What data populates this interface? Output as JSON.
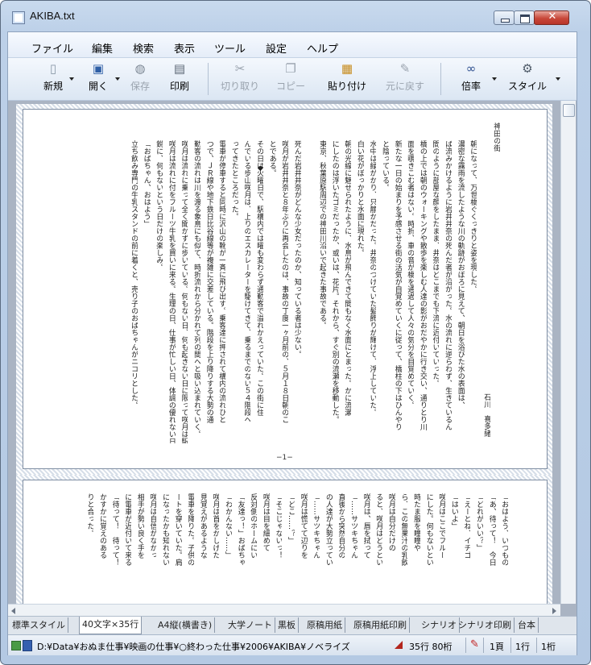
{
  "window": {
    "title": "AKIBA.txt",
    "close_glyph": "✕"
  },
  "menu": [
    "ファイル",
    "編集",
    "検索",
    "表示",
    "ツール",
    "設定",
    "ヘルプ"
  ],
  "toolbar": [
    {
      "label": "新規",
      "icon": "new-file-icon",
      "glyph": "▯"
    },
    {
      "label": "開く",
      "icon": "open-icon",
      "glyph": "▣"
    },
    {
      "label": "保存",
      "icon": "save-icon",
      "glyph": "◍"
    },
    {
      "label": "印刷",
      "icon": "print-icon",
      "glyph": "▤"
    },
    {
      "label": "切り取り",
      "icon": "cut-icon",
      "glyph": "✂"
    },
    {
      "label": "コピー",
      "icon": "copy-icon",
      "glyph": "❐"
    },
    {
      "label": "貼り付け",
      "icon": "paste-icon",
      "glyph": "▦"
    },
    {
      "label": "元に戻す",
      "icon": "undo-icon",
      "glyph": "✎"
    },
    {
      "label": "倍率",
      "icon": "zoom-icon",
      "glyph": "∞"
    },
    {
      "label": "スタイル",
      "icon": "style-icon",
      "glyph": "⚙"
    }
  ],
  "page1": {
    "title": "神田の街",
    "author": "石川　喜多緒",
    "page_number": "−1−",
    "separator": "◆",
    "columns": [
      "朝になって、万世橋ぐくっきりと姿を現した。",
      "濃密な霧雨を流したような川の軌跡がおぼろに見えて、朝日を浴びた水の表面は、",
      "ば流みかけるように岩井井奈の死んだ者が沿がった。水の流れに逆らわず、生きているん",
      "間のように部屋な顔をしたまま、井奈はどこまでも下流に近付いていった。",
      "橋の上では朝のウォーキングや散歩を楽しむ人達の影がおだやかに行き交い、通りとり川",
      "面を覗きこむ者はない。時折、車の音が橋を通過して人々の気分を目覚めていく。",
      "新たな一日の始まりを予感させる街の活気が自覚めていくに従って、橋柱の下はひんやり",
      "と陰っている。",
      "水中は緑がかり、只静かだった。井奈のつけていた髪飾りが輝けて、浮上していた。",
      "白い花がぽっかりと水面に現れた。",
      "朝の光線に魅せられたように、水鳥が飛んできて間もなく水面にとまった。かに流瀬",
      "にしたのは浮いたゴミだったか、或いは、花片。それから、すぐ別の流瀬を移動した。",
      "東京、秋葉原駅周辺での神田川沿いで起きた事故である。",
      "",
      "死んだ岩井井奈がどんな少女だったのか、知っている者は少ない。",
      "咲月が岩井井奈と８年ぶりに再会したのは、事故の丁度一ヶ月前の、５月１８日朝のこ",
      "とである。",
      "その日は火曜日で、駅構内では曜も変わらず通勤客で溢れかえっていた。この街に住",
      "んでいる歩山咲月は、上りのエスカレーターを駆けてきて、乗るまでのない５４階段へ",
      "ってきたところだった。",
      "電車が停車すると同時に沢山の靴が一斉に飛び出す。乗客達に押されて構内の流れひと",
      "つで、ＪＲ線や地下鉄日比谷線等が複雑に交差している。階段を上り降りする大勢の通",
      "勤客の流れは川を渡る象鳥にも似て、時折流れから分かれて列の間へと吸い込まれていく。",
      "咲月は流れに乗って全く聞かずに歩いている。何もない日、何も起きない日に限って咲月は駅",
      "咲月は流れに付をフルーツ牛乳を買いに来る。生理の日、仕事が忙しい日、体調の優れない日",
      "鋭に、何もないという日だけの楽しみ。",
      "「おばちゃん、おはよう」",
      "立ち飲み専門の牛乳スタンドの前に着くと、売り子のおばちゃんがニコリとした。"
    ]
  },
  "page2": {
    "columns": [
      "「おはよう、いつもの",
      "「あ、待って！　今日",
      "「どれがいい？」",
      "「えーとね、イチゴ",
      "「はいよ」",
      "咲月はここでフルー",
      "にした。何もないとい",
      "時たま服を瞳瞳や",
      "ら、この無果汁の乳飲",
      "咲月は自分だけの",
      "ると、咲月はどうとい",
      "咲月は、唇を拭って",
      "「……サツキちゃん",
      "直後から突然自分の",
      "の人達が大勢立ってい",
      "「……サツキちゃん",
      "咲月は慌てて辺りを",
      "「どこ……？」",
      "「そこじゃないっ！",
      "咲月は目を細めて",
      "反対側のホームにい",
      "「友達っ！」おばちゃ",
      "「わかんない……」",
      "咲月は首をかしげた",
      "見覚えがあるような",
      "電車を降りた。子供の",
      "ートを穿いていた。肩",
      "になったかも知れない",
      "咲月は自信がなかっ",
      "相手が勢い良く手を",
      "に電車が近付いて来る",
      "「待って！　待って！",
      "かすかに覚えのある",
      "りと合った。"
    ]
  },
  "tabs": [
    "標準スタイル",
    "40文字×35行",
    "A4縦(横書き)",
    "大学ノート",
    "黒板",
    "原稿用紙",
    "原稿用紙印刷",
    "シナリオ",
    "シナリオ印刷",
    "台本"
  ],
  "active_tab": "40文字×35行",
  "status": {
    "path": "D:¥Data¥おぬま仕事¥映画の仕事¥○終わった仕事¥2006¥AKIBA¥ノベライズ",
    "lines_cols": "35行 80桁",
    "page": "1頁",
    "line": "1行",
    "col": "1桁"
  }
}
